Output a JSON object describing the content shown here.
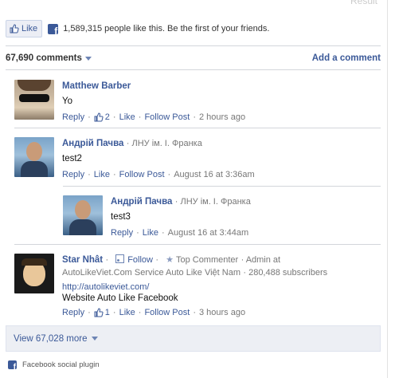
{
  "header": {
    "result_label": "Result"
  },
  "like_bar": {
    "like_button_label": "Like",
    "summary": "1,589,315 people like this. Be the first of your friends."
  },
  "toolbar": {
    "comment_count": "67,690 comments",
    "add_comment": "Add a comment"
  },
  "comments": [
    {
      "name": "Matthew Barber",
      "affiliation": "",
      "text": "Yo",
      "reply": "Reply",
      "like_count": "2",
      "like": "Like",
      "follow": "Follow Post",
      "time": "2 hours ago"
    },
    {
      "name": "Андрій Пачва",
      "affiliation": "ЛНУ ім. І. Франка",
      "text": "test2",
      "reply": "Reply",
      "like": "Like",
      "follow": "Follow Post",
      "time": "August 16 at 3:36am"
    },
    {
      "name": "Андрій Пачва",
      "affiliation": "ЛНУ ім. І. Франка",
      "text": "test3",
      "reply": "Reply",
      "like": "Like",
      "time": "August 16 at 3:44am"
    },
    {
      "name": "Star Nhât",
      "follow_label": "Follow",
      "badge": "Top Commenter",
      "role": "Admin at",
      "company_line": "AutoLikeViet.Com Service Auto Like Việt Nam",
      "subscribers": "280,488 subscribers",
      "link": "http://autolikeviet.com/",
      "text": "Website Auto Like Facebook",
      "reply": "Reply",
      "like_count": "1",
      "like": "Like",
      "follow": "Follow Post",
      "time": "3 hours ago"
    }
  ],
  "view_more": "View 67,028 more",
  "footer": {
    "label": "Facebook social plugin"
  },
  "colors": {
    "link": "#3b5998",
    "meta": "#777777",
    "panel": "#edeff4"
  },
  "icons": [
    "thumbs-up-icon",
    "facebook-logo-icon",
    "chevron-down-icon",
    "follow-rss-icon",
    "star-icon"
  ]
}
